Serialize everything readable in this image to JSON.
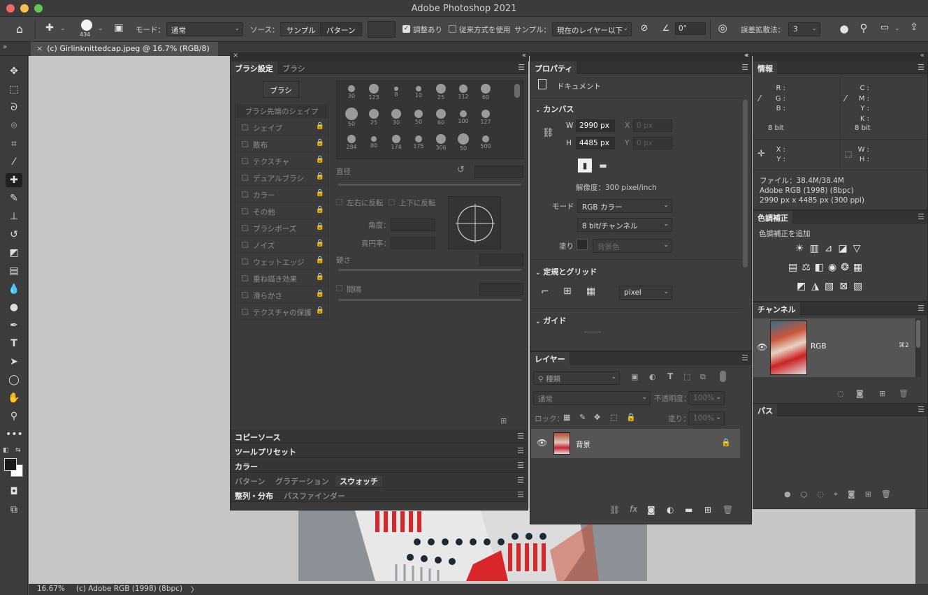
{
  "window": {
    "title": "Adobe Photoshop 2021"
  },
  "colors": {
    "close": "#ed6a5e",
    "minimize": "#f5bf4f",
    "zoom": "#61c554"
  },
  "options": {
    "brush_size": "434",
    "mode_label": "モード：",
    "mode_value": "通常",
    "source_label": "ソース：",
    "sampled_button": "サンプル",
    "pattern_button": "パターン",
    "aligned_label": "調整あり",
    "legacy_label": "従来方式を使用",
    "sample_label": "サンプル：",
    "sample_value": "現在のレイヤー以下",
    "angle_value": "0°",
    "diffusion_label": "誤差拡散法：",
    "diffusion_value": "3"
  },
  "document": {
    "tab_title": "(c) Girlinknittedcap.jpeg @ 16.7% (RGB/8)"
  },
  "status": {
    "zoom": "16.67%",
    "profile": "(c) Adobe RGB (1998) (8bpc)",
    "arrow": "〉"
  },
  "brush_settings": {
    "tab_active": "ブラシ設定",
    "tab_inactive": "ブラシ",
    "brush_button": "ブラシ",
    "tip_shape": "ブラシ先端のシェイプ",
    "items": [
      "シェイプ",
      "散布",
      "テクスチャ",
      "デュアルブラシ",
      "カラー",
      "その他",
      "ブラシポーズ",
      "ノイズ",
      "ウェットエッジ",
      "重ね描き効果",
      "滑らかさ",
      "テクスチャの保護"
    ],
    "brush_sizes": [
      "30",
      "123",
      "8",
      "10",
      "25",
      "112",
      "60",
      "50",
      "25",
      "30",
      "50",
      "60",
      "100",
      "127",
      "284",
      "80",
      "174",
      "175",
      "306",
      "50",
      "500"
    ],
    "size_label": "直径",
    "flip_x": "左右に反転",
    "flip_y": "上下に反転",
    "angle_label": "角度：",
    "roundness_label": "真円率：",
    "hardness_label": "硬さ",
    "spacing_label": "間隔"
  },
  "collapsed_panels": {
    "clone_source": "コピーソース",
    "tool_presets": "ツールプリセット",
    "color": "カラー",
    "patterns": "パターン",
    "gradients": "グラデーション",
    "swatches": "スウォッチ",
    "align": "整列・分布",
    "pathfinder": "パスファインダー"
  },
  "properties": {
    "tab": "プロパティ",
    "doc_label": "ドキュメント",
    "canvas_section": "カンバス",
    "w_label": "W",
    "h_label": "H",
    "w_value": "2990 px",
    "h_value": "4485 px",
    "x_label": "X",
    "y_label": "Y",
    "x_placeholder": "0 px",
    "y_placeholder": "0 px",
    "resolution": "解像度：300 pixel/inch",
    "mode_label": "モード",
    "mode_value": "RGB カラー",
    "depth_value": "8 bit/チャンネル",
    "fill_label": "塗り",
    "fill_value": "背景色",
    "rulers_section": "定規とグリッド",
    "unit_value": "pixel",
    "guides_section": "ガイド"
  },
  "layers": {
    "tab": "レイヤー",
    "kind": "種類",
    "blend": "通常",
    "opacity_label": "不透明度：",
    "opacity_value": "100%",
    "lock_label": "ロック：",
    "fill_label": "塗り：",
    "fill_value": "100%",
    "layer_name": "背景"
  },
  "info": {
    "tab": "情報",
    "r": "R :",
    "g": "G :",
    "b": "B :",
    "c": "C :",
    "m": "M :",
    "y": "Y :",
    "k": "K :",
    "bit_left": "8 bit",
    "bit_right": "8 bit",
    "x": "X :",
    "yy": "Y :",
    "w": "W :",
    "h": "H :",
    "file": "ファイル：38.4M/38.4M",
    "profile": "Adobe RGB (1998) (8bpc)",
    "dims": "2990 px x 4485 px (300 ppi)"
  },
  "adjustments": {
    "tab": "色調補正",
    "add_label": "色調補正を追加"
  },
  "channels": {
    "tab": "チャンネル",
    "channel_name": "RGB",
    "shortcut": "⌘2"
  },
  "paths": {
    "tab": "パス"
  }
}
